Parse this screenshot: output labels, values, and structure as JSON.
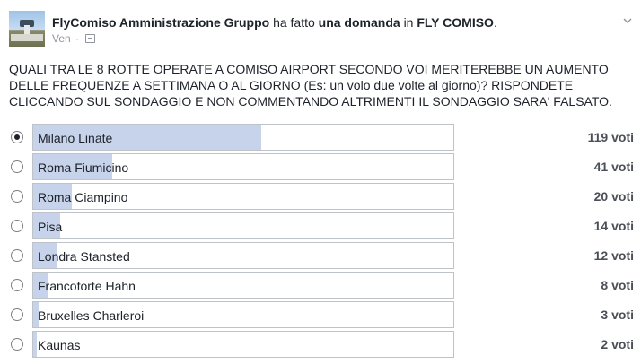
{
  "post": {
    "author": "FlyComiso Amministrazione Gruppo",
    "verb_text": "ha fatto",
    "action": "una domanda",
    "in_text": "in",
    "group": "FLY COMISO",
    "period": ".",
    "timestamp": "Ven",
    "avatar_icon": "airport-tower-avatar",
    "audience_icon": "group-audience-icon",
    "menu_icon": "chevron-down-icon"
  },
  "question": "QUALI TRA LE 8 ROTTE OPERATE A COMISO AIRPORT SECONDO VOI MERITEREBBE UN AUMENTO DELLE FREQUENZE A SETTIMANA O AL GIORNO (Es: un volo due volte al giorno)? RISPONDETE CLICCANDO SUL SONDAGGIO E NON COMMENTANDO ALTRIMENTI IL SONDAGGIO SARA' FALSATO.",
  "poll": {
    "bar_color": "#c6d3ea",
    "options": [
      {
        "label": "Milano Linate",
        "votes": 119,
        "votes_text": "119 voti",
        "selected": true
      },
      {
        "label": "Roma Fiumicino",
        "votes": 41,
        "votes_text": "41 voti",
        "selected": false
      },
      {
        "label": "Roma Ciampino",
        "votes": 20,
        "votes_text": "20 voti",
        "selected": false
      },
      {
        "label": "Pisa",
        "votes": 14,
        "votes_text": "14 voti",
        "selected": false
      },
      {
        "label": "Londra Stansted",
        "votes": 12,
        "votes_text": "12 voti",
        "selected": false
      },
      {
        "label": "Francoforte Hahn",
        "votes": 8,
        "votes_text": "8 voti",
        "selected": false
      },
      {
        "label": "Bruxelles Charleroi",
        "votes": 3,
        "votes_text": "3 voti",
        "selected": false
      },
      {
        "label": "Kaunas",
        "votes": 2,
        "votes_text": "2 voti",
        "selected": false
      }
    ]
  }
}
